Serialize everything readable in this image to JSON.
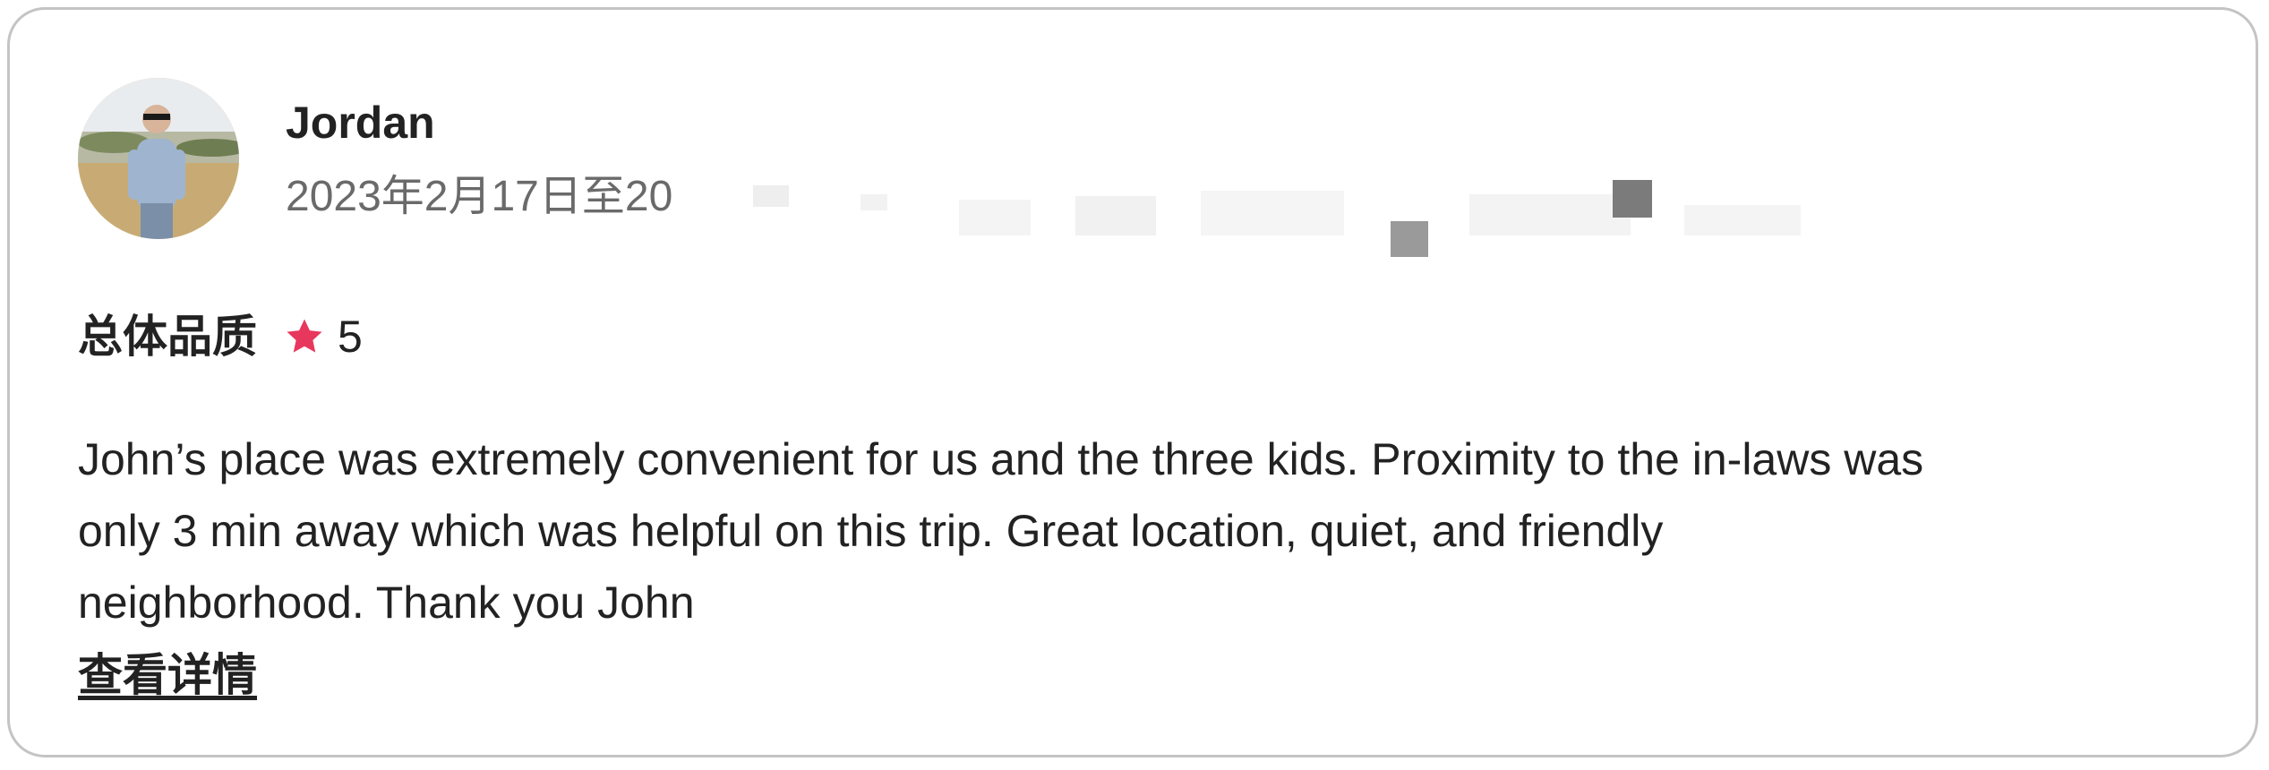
{
  "review": {
    "reviewer": {
      "name": "Jordan",
      "avatar_icon": "user-avatar-photo"
    },
    "stay_dates": "2023年2月17日至20",
    "rating": {
      "label": "总体品质",
      "icon": "star-icon",
      "value": "5",
      "star_color": "#e8375c"
    },
    "text_lines": [
      "John’s place was extremely convenient for us and the three kids. Proximity to the in-laws was",
      "only 3 min away which was helpful on this trip. Great location, quiet, and friendly",
      "neighborhood. Thank you John"
    ],
    "read_more_label": "查看详情"
  }
}
